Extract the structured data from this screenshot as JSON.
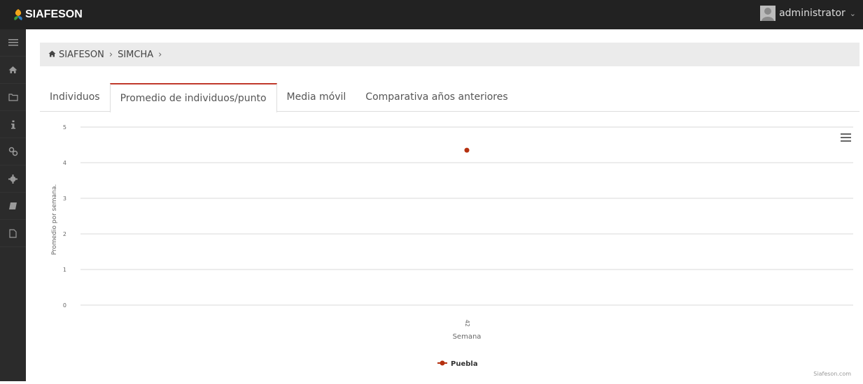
{
  "app": {
    "brand": "SIAFESON"
  },
  "user": {
    "name": "administrator"
  },
  "breadcrumb": {
    "items": [
      "SIAFESON",
      "SIMCHA"
    ]
  },
  "tabs": [
    {
      "label": "Individuos",
      "active": false
    },
    {
      "label": "Promedio de individuos/punto",
      "active": true
    },
    {
      "label": "Media móvil",
      "active": false
    },
    {
      "label": "Comparativa años anteriores",
      "active": false
    }
  ],
  "sidebar": {
    "icons": [
      "menu-icon",
      "home-icon",
      "folder-icon",
      "info-icon",
      "link-icon",
      "gear-icon",
      "book-icon",
      "file-icon"
    ]
  },
  "colors": {
    "accent": "#c0392b",
    "series": "#b5300f",
    "topbar": "#222222",
    "sidebar": "#2b2b2b"
  },
  "chart_data": {
    "type": "line",
    "ylabel": "Promedio por semana.",
    "xlabel": "Semana",
    "x": [
      "42"
    ],
    "ylim": [
      0,
      5
    ],
    "yticks": [
      "0",
      "1",
      "2",
      "3",
      "4",
      "5"
    ],
    "series": [
      {
        "name": "Puebla",
        "values": [
          4.35
        ]
      }
    ],
    "grid": true,
    "legend": "bottom-center",
    "credit": "Siafeson.com"
  }
}
